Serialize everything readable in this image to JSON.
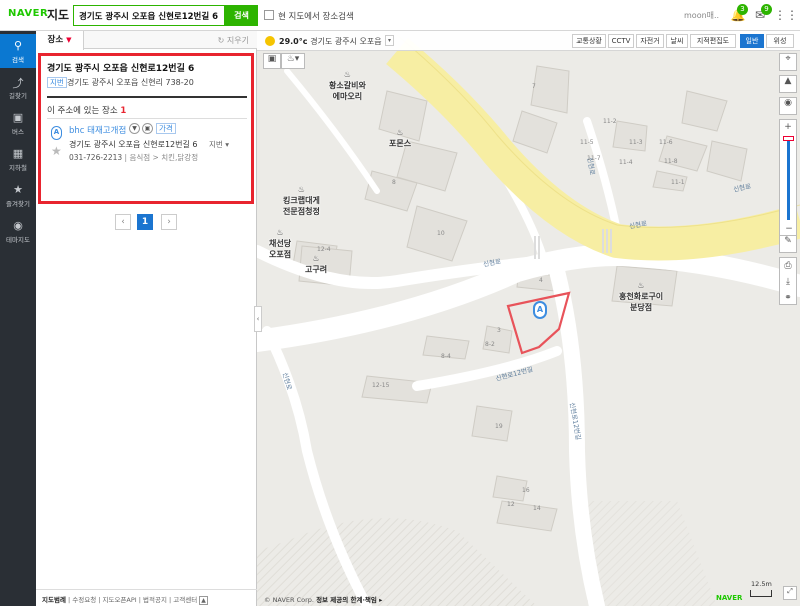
{
  "header": {
    "logo": "NAVER",
    "logo_map": "지도",
    "search_value": "경기도 광주시 오포읍 신현로12번길 6",
    "search_button": "검색",
    "in_map_search": "현 지도에서 장소검색",
    "user": "moon매..",
    "bell_count": "3",
    "mail_count": "9"
  },
  "nav": {
    "items": [
      {
        "label": "검색"
      },
      {
        "label": "길찾기"
      },
      {
        "label": "버스"
      },
      {
        "label": "지하철"
      },
      {
        "label": "즐겨찾기"
      },
      {
        "label": "테마지도"
      }
    ]
  },
  "panel": {
    "tab_place": "장소",
    "clear": "지우기",
    "result": {
      "title": "경기도 광주시 오포읍 신현로12번길 6",
      "jibun_tag": "지번",
      "jibun_addr": "경기도 광주시 오포읍 신현리 738-20",
      "count_text": "이 주소에 있는 장소",
      "count": "1",
      "place": {
        "marker": "A",
        "name": "bhc 태재고개점",
        "price_tag": "가격",
        "address": "경기도 광주시 오포읍 신현로12번길 6",
        "jibun_dd": "지번",
        "phone": "031-726-2213",
        "category": "음식점 > 치킨,닭강정"
      }
    },
    "page": "1",
    "footer": [
      "지도범례",
      "수정요청",
      "지도오픈API",
      "법적공지",
      "고객센터"
    ]
  },
  "map": {
    "weather_temp": "29.0°c",
    "weather_place": "경기도 광주시 오포읍",
    "layers": [
      "교통상황",
      "CCTV",
      "자전거",
      "날씨",
      "지적편집도",
      "일반",
      "위성"
    ],
    "active_layer": "일반",
    "labels": {
      "hwangso": "황소갈비와\n에마오리",
      "pormos": "포몬스",
      "king": "킹크랩대게\n전문점청정",
      "chaeseon": "채선당\n오포점",
      "goguryeo": "고구려",
      "hongcheon": "홍천화로구이\n분당점"
    },
    "roads": {
      "sinhyeon1": "신현로",
      "sinhyeon2": "신현로",
      "sinhyeon3": "신현로",
      "sinhyeon12": "신현로12번길",
      "sinhyeon12v": "신현로12번길",
      "sinhyeon_v1": "신현로",
      "sinhyeon_v2": "신현로"
    },
    "numbers": [
      "7",
      "11-2",
      "11-5",
      "11-3",
      "11-7",
      "11-6",
      "11-4",
      "11-8",
      "11-1",
      "8",
      "10",
      "12-4",
      "4",
      "3",
      "8-2",
      "8-4",
      "12-15",
      "19",
      "16",
      "12",
      "14"
    ],
    "marker": "A",
    "copyright": "© NAVER Corp.",
    "info_link": "정보 제공의 한계·책임 ▸",
    "naver_logo": "NAVER",
    "scale": "12.5m"
  }
}
